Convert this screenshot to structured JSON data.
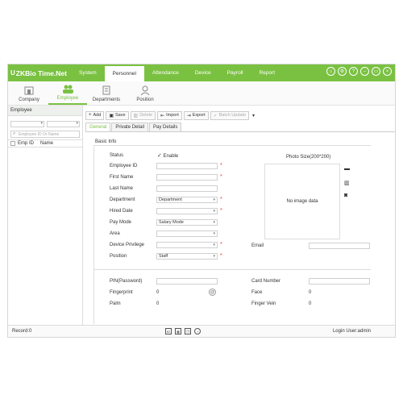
{
  "app": {
    "logo_mark": "U",
    "logo_text": "ZKBio Time.Net"
  },
  "menu": [
    "System",
    "Personnel",
    "Attendance",
    "Device",
    "Payroll",
    "Report"
  ],
  "top_icons": [
    "⌂",
    "⚙",
    "?",
    "–",
    "▭",
    "×"
  ],
  "subnav": [
    "Company",
    "Employee",
    "Departments",
    "Position"
  ],
  "left": {
    "title": "Employee",
    "search_placeholder": "Employee ID Or Name",
    "col_id": "Emp ID",
    "col_name": "Name"
  },
  "toolbar": {
    "add": "Add",
    "save": "Save",
    "delete": "Delete",
    "import": "Import",
    "export": "Export",
    "batch": "Batch Update"
  },
  "tabs": [
    "General",
    "Private Detail",
    "Pay Details"
  ],
  "form": {
    "section": "Basic Info",
    "status_label": "Status",
    "status_value": "Enable",
    "employee_id": "Employee ID",
    "first_name": "First Name",
    "last_name": "Last Name",
    "department": "Department",
    "department_value": "Department",
    "hired_date": "Hired Date",
    "pay_mode": "Pay Mode",
    "pay_mode_value": "Salary Mode",
    "area": "Area",
    "device_privilege": "Device Privilege",
    "position": "Position",
    "position_value": "Staff",
    "photo_size": "Photo Size(200*200)",
    "no_image": "No image data",
    "email": "Email",
    "pin": "PIN(Password)",
    "card_number": "Card Number",
    "fingerprint": "Fingerprint",
    "fingerprint_value": "0",
    "face": "Face",
    "face_value": "0",
    "palm": "Palm",
    "palm_value": "0",
    "finger_vein": "Finger Vein",
    "finger_vein_value": "0"
  },
  "status": {
    "record": "Record:0",
    "login": "Login User:admin"
  },
  "colors": {
    "brand": "#7ac142"
  }
}
